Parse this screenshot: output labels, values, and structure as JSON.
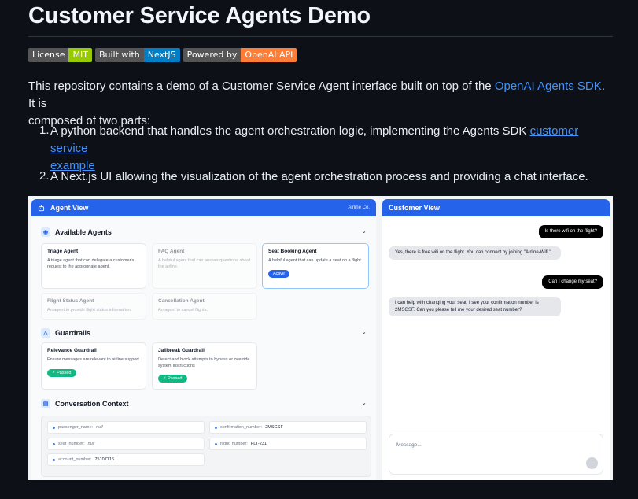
{
  "readme": {
    "title": "Customer Service Agents Demo",
    "badges": [
      {
        "key": "License",
        "value": "MIT",
        "color": "#97ca00"
      },
      {
        "key": "Built with",
        "value": "NextJS",
        "color": "#007ec6"
      },
      {
        "key": "Powered by",
        "value": "OpenAI API",
        "color": "#fe7d37"
      }
    ],
    "intro_pre": "This repository contains a demo of a Customer Service Agent interface built on top of the ",
    "intro_link": "OpenAI Agents SDK",
    "intro_post": ". It is",
    "intro_line2": "composed of two parts:",
    "list": [
      {
        "num": "1.",
        "text": "A python backend that handles the agent orchestration logic, implementing the Agents SDK ",
        "link": "customer service",
        "link2": "example"
      },
      {
        "num": "2.",
        "text": "A Next.js UI allowing the visualization of the agent orchestration process and providing a chat interface."
      }
    ]
  },
  "agent_view": {
    "title": "Agent View",
    "subtitle": "Airline Co.",
    "available_agents": {
      "title": "Available Agents",
      "agents": [
        {
          "name": "Triage Agent",
          "desc": "A triage agent that can delegate a customer's request to the appropriate agent."
        },
        {
          "name": "FAQ Agent",
          "desc": "A helpful agent that can answer questions about the airline."
        },
        {
          "name": "Seat Booking Agent",
          "desc": "A helpful agent that can update a seat on a flight.",
          "status": "Active"
        },
        {
          "name": "Flight Status Agent",
          "desc": "An agent to provide flight status information."
        },
        {
          "name": "Cancellation Agent",
          "desc": "An agent to cancel flights."
        }
      ]
    },
    "guardrails": {
      "title": "Guardrails",
      "items": [
        {
          "name": "Relevance Guardrail",
          "desc": "Ensure messages are relevant to airline support",
          "status": "Passed"
        },
        {
          "name": "Jailbreak Guardrail",
          "desc": "Detect and block attempts to bypass or override system instructions",
          "status": "Passed"
        }
      ]
    },
    "context": {
      "title": "Conversation Context",
      "fields": [
        {
          "key": "passenger_name:",
          "value": "null",
          "is_null": true
        },
        {
          "key": "confirmation_number:",
          "value": "2MSGSF",
          "is_null": false
        },
        {
          "key": "seat_number:",
          "value": "null",
          "is_null": true
        },
        {
          "key": "flight_number:",
          "value": "FLT-231",
          "is_null": false
        },
        {
          "key": "account_number:",
          "value": "75107716",
          "is_null": false
        }
      ]
    }
  },
  "customer_view": {
    "title": "Customer View",
    "messages": [
      {
        "role": "user",
        "text": "Is there wifi on the flight?"
      },
      {
        "role": "bot",
        "text": "Yes, there is free wifi on the flight. You can connect by joining \"Airline-Wifi.\""
      },
      {
        "role": "user",
        "text": "Can I change my seat?"
      },
      {
        "role": "bot",
        "text": "I can help with changing your seat. I see your confirmation number is 2MSGSF. Can you please tell me your desired seat number?"
      }
    ],
    "input_placeholder": "Message..."
  }
}
